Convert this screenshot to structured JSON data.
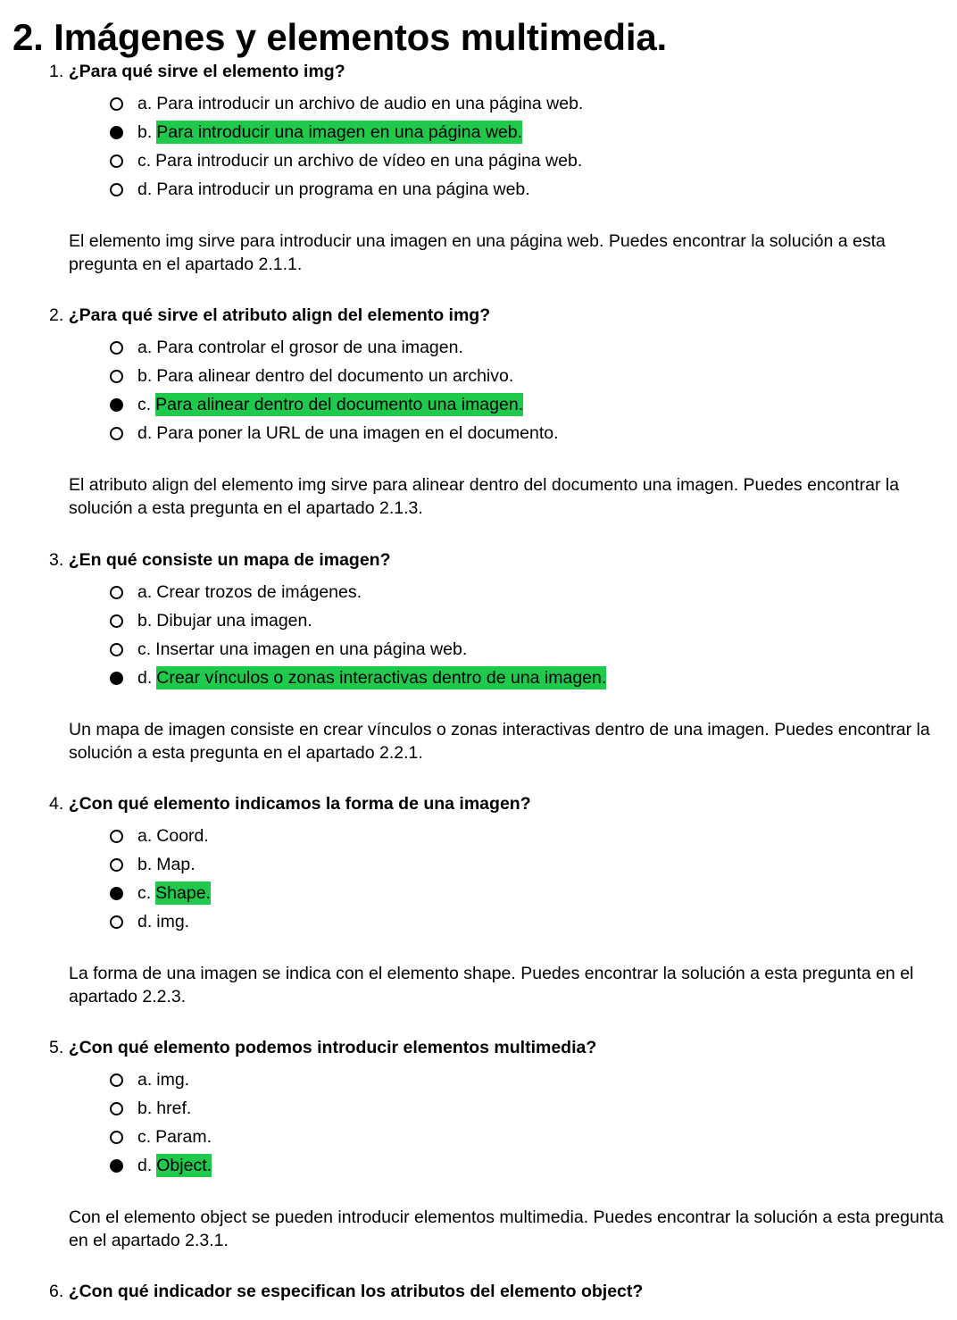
{
  "page_title": "2. Imágenes y elementos multimedia.",
  "questions": [
    {
      "number": "1.",
      "text": "¿Para qué sirve el elemento img?",
      "options": [
        {
          "letter": "a.",
          "text": "Para introducir un archivo de audio en una página web.",
          "selected": false,
          "correct": false
        },
        {
          "letter": "b.",
          "text": "Para introducir una imagen en una página web.",
          "selected": true,
          "correct": true
        },
        {
          "letter": "c.",
          "text": "Para introducir un archivo de vídeo en una página web.",
          "selected": false,
          "correct": false
        },
        {
          "letter": "d.",
          "text": "Para introducir un programa en una página web.",
          "selected": false,
          "correct": false
        }
      ],
      "feedback": "El elemento img sirve para introducir una imagen en una página web. Puedes encontrar la solución a esta pregunta en el apartado 2.1.1."
    },
    {
      "number": "2.",
      "text": "¿Para qué sirve el atributo align del elemento img?",
      "options": [
        {
          "letter": "a.",
          "text": "Para controlar el grosor de una imagen.",
          "selected": false,
          "correct": false
        },
        {
          "letter": "b.",
          "text": "Para alinear dentro del documento un archivo.",
          "selected": false,
          "correct": false
        },
        {
          "letter": "c.",
          "text": "Para alinear dentro del documento una imagen.",
          "selected": true,
          "correct": true
        },
        {
          "letter": "d.",
          "text": "Para poner la URL de una imagen en el documento.",
          "selected": false,
          "correct": false
        }
      ],
      "feedback": "El atributo align del elemento img sirve para alinear dentro del documento una imagen. Puedes encontrar la solución a esta pregunta en el apartado 2.1.3."
    },
    {
      "number": "3.",
      "text": "¿En qué consiste un mapa de imagen?",
      "options": [
        {
          "letter": "a.",
          "text": "Crear trozos de imágenes.",
          "selected": false,
          "correct": false
        },
        {
          "letter": "b.",
          "text": "Dibujar una imagen.",
          "selected": false,
          "correct": false
        },
        {
          "letter": "c.",
          "text": "Insertar una imagen en una página web.",
          "selected": false,
          "correct": false
        },
        {
          "letter": "d.",
          "text": "Crear vínculos o zonas interactivas dentro de una imagen.",
          "selected": true,
          "correct": true
        }
      ],
      "feedback": "Un mapa de imagen consiste en crear vínculos o zonas interactivas dentro de una imagen. Puedes encontrar la solución a esta pregunta en el apartado 2.2.1."
    },
    {
      "number": "4.",
      "text": "¿Con qué elemento indicamos la forma de una imagen?",
      "options": [
        {
          "letter": "a.",
          "text": "Coord.",
          "selected": false,
          "correct": false
        },
        {
          "letter": "b.",
          "text": "Map.",
          "selected": false,
          "correct": false
        },
        {
          "letter": "c.",
          "text": "Shape.",
          "selected": true,
          "correct": true
        },
        {
          "letter": "d.",
          "text": "img.",
          "selected": false,
          "correct": false
        }
      ],
      "feedback": "La forma de una imagen se indica con el elemento shape. Puedes encontrar la solución a esta pregunta en el apartado 2.2.3."
    },
    {
      "number": "5.",
      "text": "¿Con qué elemento podemos introducir elementos multimedia?",
      "options": [
        {
          "letter": "a.",
          "text": "img.",
          "selected": false,
          "correct": false
        },
        {
          "letter": "b.",
          "text": "href.",
          "selected": false,
          "correct": false
        },
        {
          "letter": "c.",
          "text": "Param.",
          "selected": false,
          "correct": false
        },
        {
          "letter": "d.",
          "text": "Object.",
          "selected": true,
          "correct": true
        }
      ],
      "feedback": "Con el elemento object se pueden introducir elementos multimedia. Puedes encontrar la solución a esta pregunta en el apartado 2.3.1."
    },
    {
      "number": "6.",
      "text": "¿Con qué indicador se especifican los atributos del elemento object?"
    }
  ],
  "colors": {
    "correct_highlight": "#1fc94b",
    "text": "#000000"
  }
}
